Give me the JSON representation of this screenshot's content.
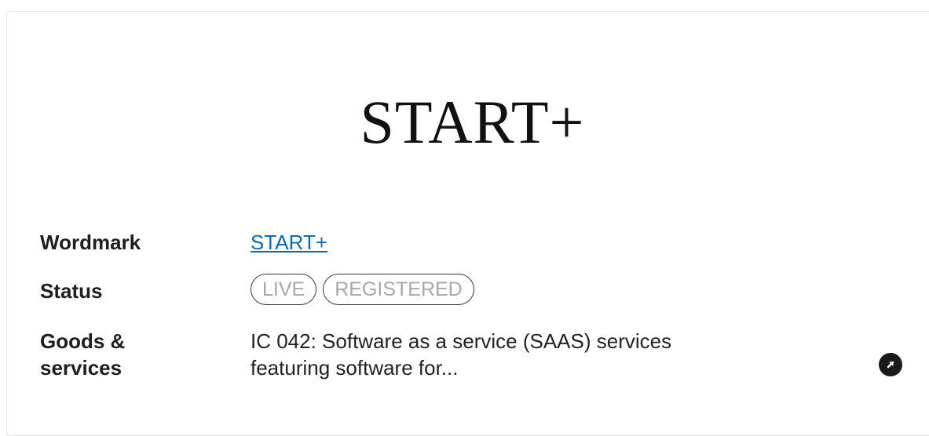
{
  "logo": {
    "text": "START+"
  },
  "details": {
    "wordmark": {
      "label": "Wordmark",
      "value": "START+"
    },
    "status": {
      "label": "Status",
      "badges": [
        "LIVE",
        "REGISTERED"
      ]
    },
    "goods_services": {
      "label_line1": "Goods &",
      "label_line2": "services",
      "value_line1": "IC 042: Software as a service (SAAS) services",
      "value_line2": "featuring software for..."
    }
  },
  "icons": {
    "open": "arrow-up-right-icon"
  },
  "colors": {
    "link": "#0f6ab4",
    "badge_text": "#a8a8a8",
    "badge_border": "#3a3a3a",
    "button_bg": "#1a1a1a"
  }
}
